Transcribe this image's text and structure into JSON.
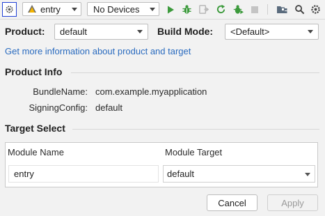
{
  "toolbar": {
    "settings_icon": "gear-icon",
    "module_selector": {
      "value": "entry",
      "icon": "harmony-module-icon"
    },
    "device_selector": {
      "value": "No Devices"
    },
    "icons": [
      "run-icon",
      "debug-icon",
      "attach-debugger-icon",
      "rerun-icon",
      "profile-icon",
      "stop-icon",
      "project-structure-icon",
      "search-icon",
      "settings-icon"
    ],
    "colors": {
      "run": "#3c9a3c",
      "debug": "#3c9a3c",
      "disabled": "#b8b8b8",
      "highlight_border": "#1f3fd4"
    }
  },
  "form": {
    "product_label": "Product:",
    "product_value": "default",
    "build_mode_label": "Build Mode:",
    "build_mode_value": "<Default>"
  },
  "info_link": "Get more information about product and target",
  "product_info": {
    "title": "Product Info",
    "rows": [
      {
        "key": "BundleName:",
        "value": "com.example.myapplication"
      },
      {
        "key": "SigningConfig:",
        "value": "default"
      }
    ]
  },
  "target_select": {
    "title": "Target Select",
    "columns": [
      "Module Name",
      "Module Target"
    ],
    "rows": [
      {
        "module_name": "entry",
        "module_target": "default"
      }
    ]
  },
  "buttons": {
    "cancel": "Cancel",
    "apply": "Apply"
  }
}
